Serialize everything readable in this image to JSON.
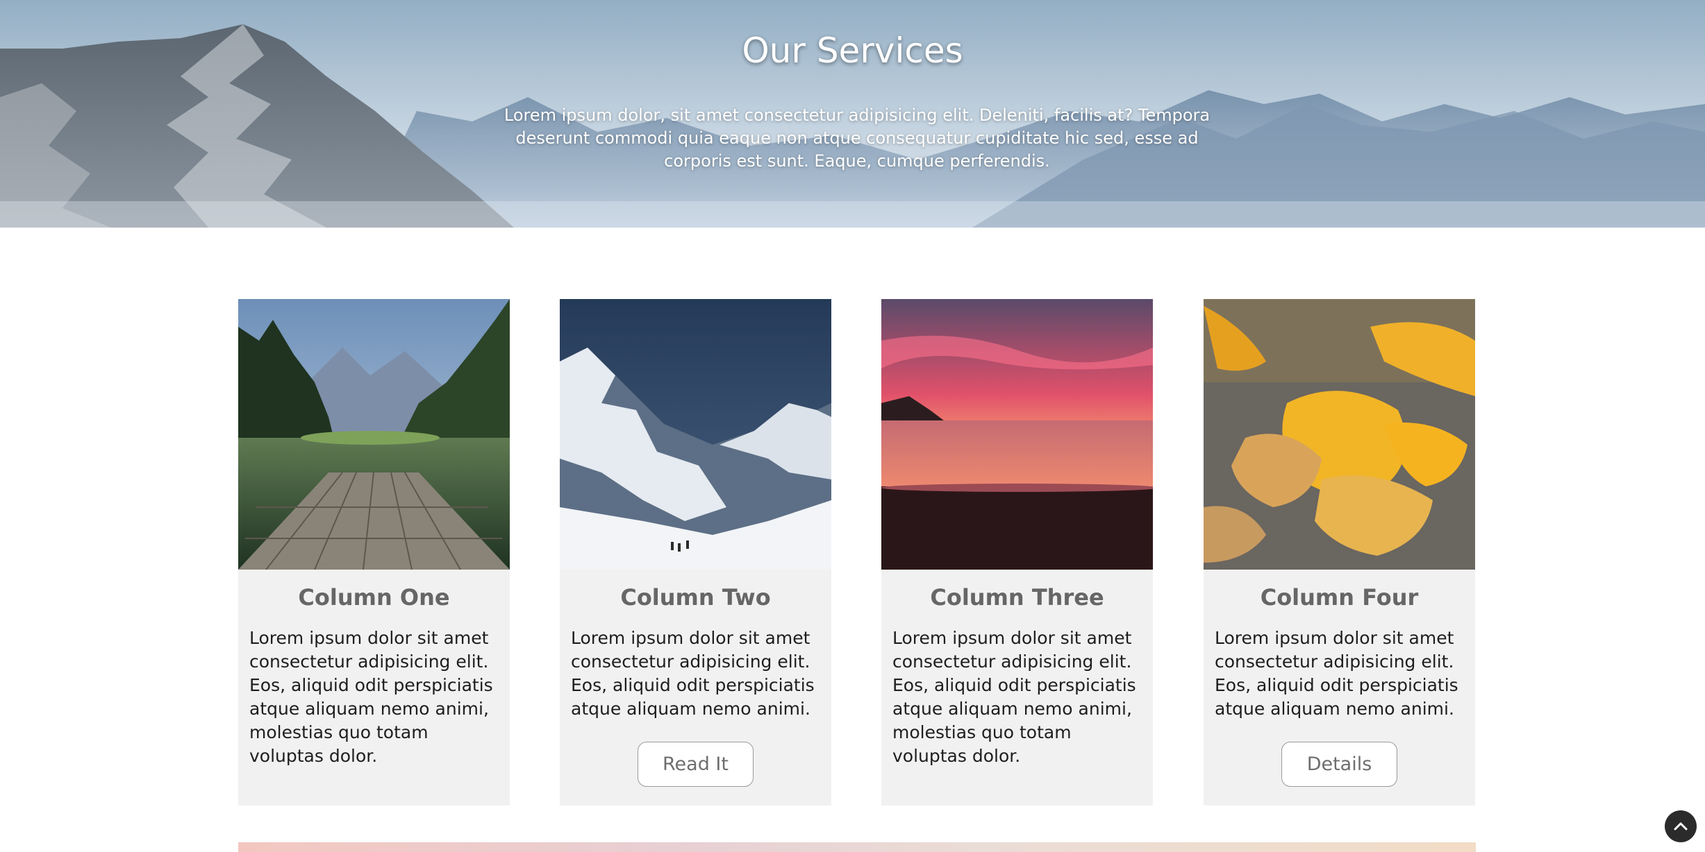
{
  "hero": {
    "title": "Our Services",
    "text": "Lorem ipsum dolor, sit amet consectetur adipisicing elit. Deleniti, facilis at? Tempora deserunt commodi quia eaque non atque consequatur cupiditate hic sed, esse ad corporis est sunt. Eaque, cumque perferendis."
  },
  "cards": [
    {
      "title": "Column One",
      "text": "Lorem ipsum dolor sit amet consectetur adipisicing elit. Eos, aliquid odit perspiciatis atque aliquam nemo animi, molestias quo totam voluptas dolor.",
      "button": ""
    },
    {
      "title": "Column Two",
      "text": "Lorem ipsum dolor sit amet consectetur adipisicing elit. Eos, aliquid odit perspiciatis atque aliquam nemo animi.",
      "button": "Read It"
    },
    {
      "title": "Column Three",
      "text": "Lorem ipsum dolor sit amet consectetur adipisicing elit. Eos, aliquid odit perspiciatis atque aliquam nemo animi, molestias quo totam voluptas dolor.",
      "button": ""
    },
    {
      "title": "Column Four",
      "text": "Lorem ipsum dolor sit amet consectetur adipisicing elit. Eos, aliquid odit perspiciatis atque aliquam nemo animi.",
      "button": "Details"
    }
  ],
  "scroll_top": {
    "icon": "chevron-up-icon"
  },
  "colors": {
    "card_bg": "#f1f1f1",
    "card_title": "#666666",
    "button_border": "#9a9a9a",
    "scroll_top_bg": "#2b2b2b"
  }
}
